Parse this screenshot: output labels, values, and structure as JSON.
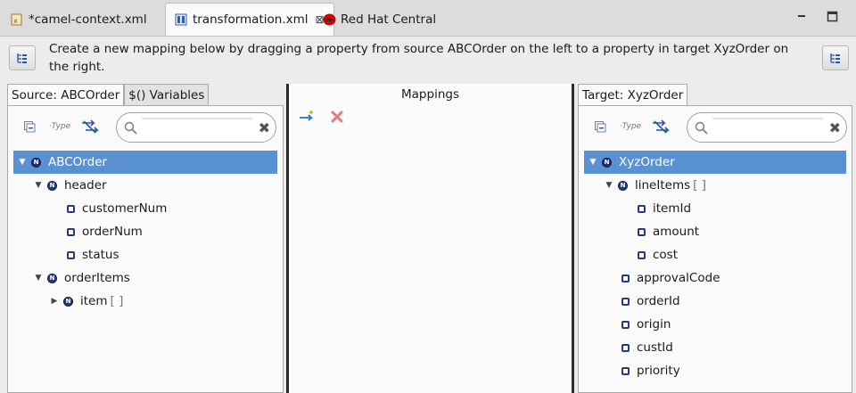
{
  "editor_tabs": [
    {
      "label": "*camel-context.xml",
      "icon": "xml-file-icon",
      "active": false
    },
    {
      "label": "transformation.xml",
      "icon": "transformation-file-icon",
      "active": true
    },
    {
      "label": "Red Hat Central",
      "icon": "redhat-icon",
      "active": false
    }
  ],
  "instruction": "Create a new mapping below by dragging a property from source ABCOrder on the left to a property in target XyzOrder  on the right.",
  "source": {
    "tabs": [
      "Source: ABCOrder",
      "$() Variables"
    ],
    "search_value": "",
    "toolbar_icons": [
      "collapse-all-icon",
      "show-type-icon",
      "filter-mapped-icon"
    ],
    "tree": [
      {
        "label": "ABCOrder",
        "level": 0,
        "kind": "node",
        "expanded": true,
        "selected": true
      },
      {
        "label": "header",
        "level": 1,
        "kind": "node",
        "expanded": true
      },
      {
        "label": "customerNum",
        "level": 2,
        "kind": "leaf"
      },
      {
        "label": "orderNum",
        "level": 2,
        "kind": "leaf"
      },
      {
        "label": "status",
        "level": 2,
        "kind": "leaf"
      },
      {
        "label": "orderItems",
        "level": 1,
        "kind": "node",
        "expanded": true
      },
      {
        "label": "item",
        "suffix": "[ ]",
        "level": 2,
        "kind": "node",
        "expanded": false
      }
    ]
  },
  "mappings": {
    "title": "Mappings",
    "toolbar_icons": [
      "add-mapping-icon",
      "delete-mapping-icon"
    ]
  },
  "target": {
    "tabs": [
      "Target: XyzOrder"
    ],
    "search_value": "",
    "toolbar_icons": [
      "collapse-all-icon",
      "show-type-icon",
      "filter-mapped-icon"
    ],
    "tree": [
      {
        "label": "XyzOrder",
        "level": 0,
        "kind": "node",
        "expanded": true,
        "selected": true
      },
      {
        "label": "lineItems",
        "suffix": "[ ]",
        "level": 1,
        "kind": "node",
        "expanded": true
      },
      {
        "label": "itemId",
        "level": 2,
        "kind": "leaf"
      },
      {
        "label": "amount",
        "level": 2,
        "kind": "leaf"
      },
      {
        "label": "cost",
        "level": 2,
        "kind": "leaf"
      },
      {
        "label": "approvalCode",
        "level": 1,
        "kind": "leaf"
      },
      {
        "label": "orderId",
        "level": 1,
        "kind": "leaf"
      },
      {
        "label": "origin",
        "level": 1,
        "kind": "leaf"
      },
      {
        "label": "custId",
        "level": 1,
        "kind": "leaf"
      },
      {
        "label": "priority",
        "level": 1,
        "kind": "leaf"
      }
    ]
  },
  "colors": {
    "selection": "#5a91d2",
    "node": "#243a7a",
    "add_arrow": "#2a6fd0",
    "delete_x": "#e27b84"
  }
}
